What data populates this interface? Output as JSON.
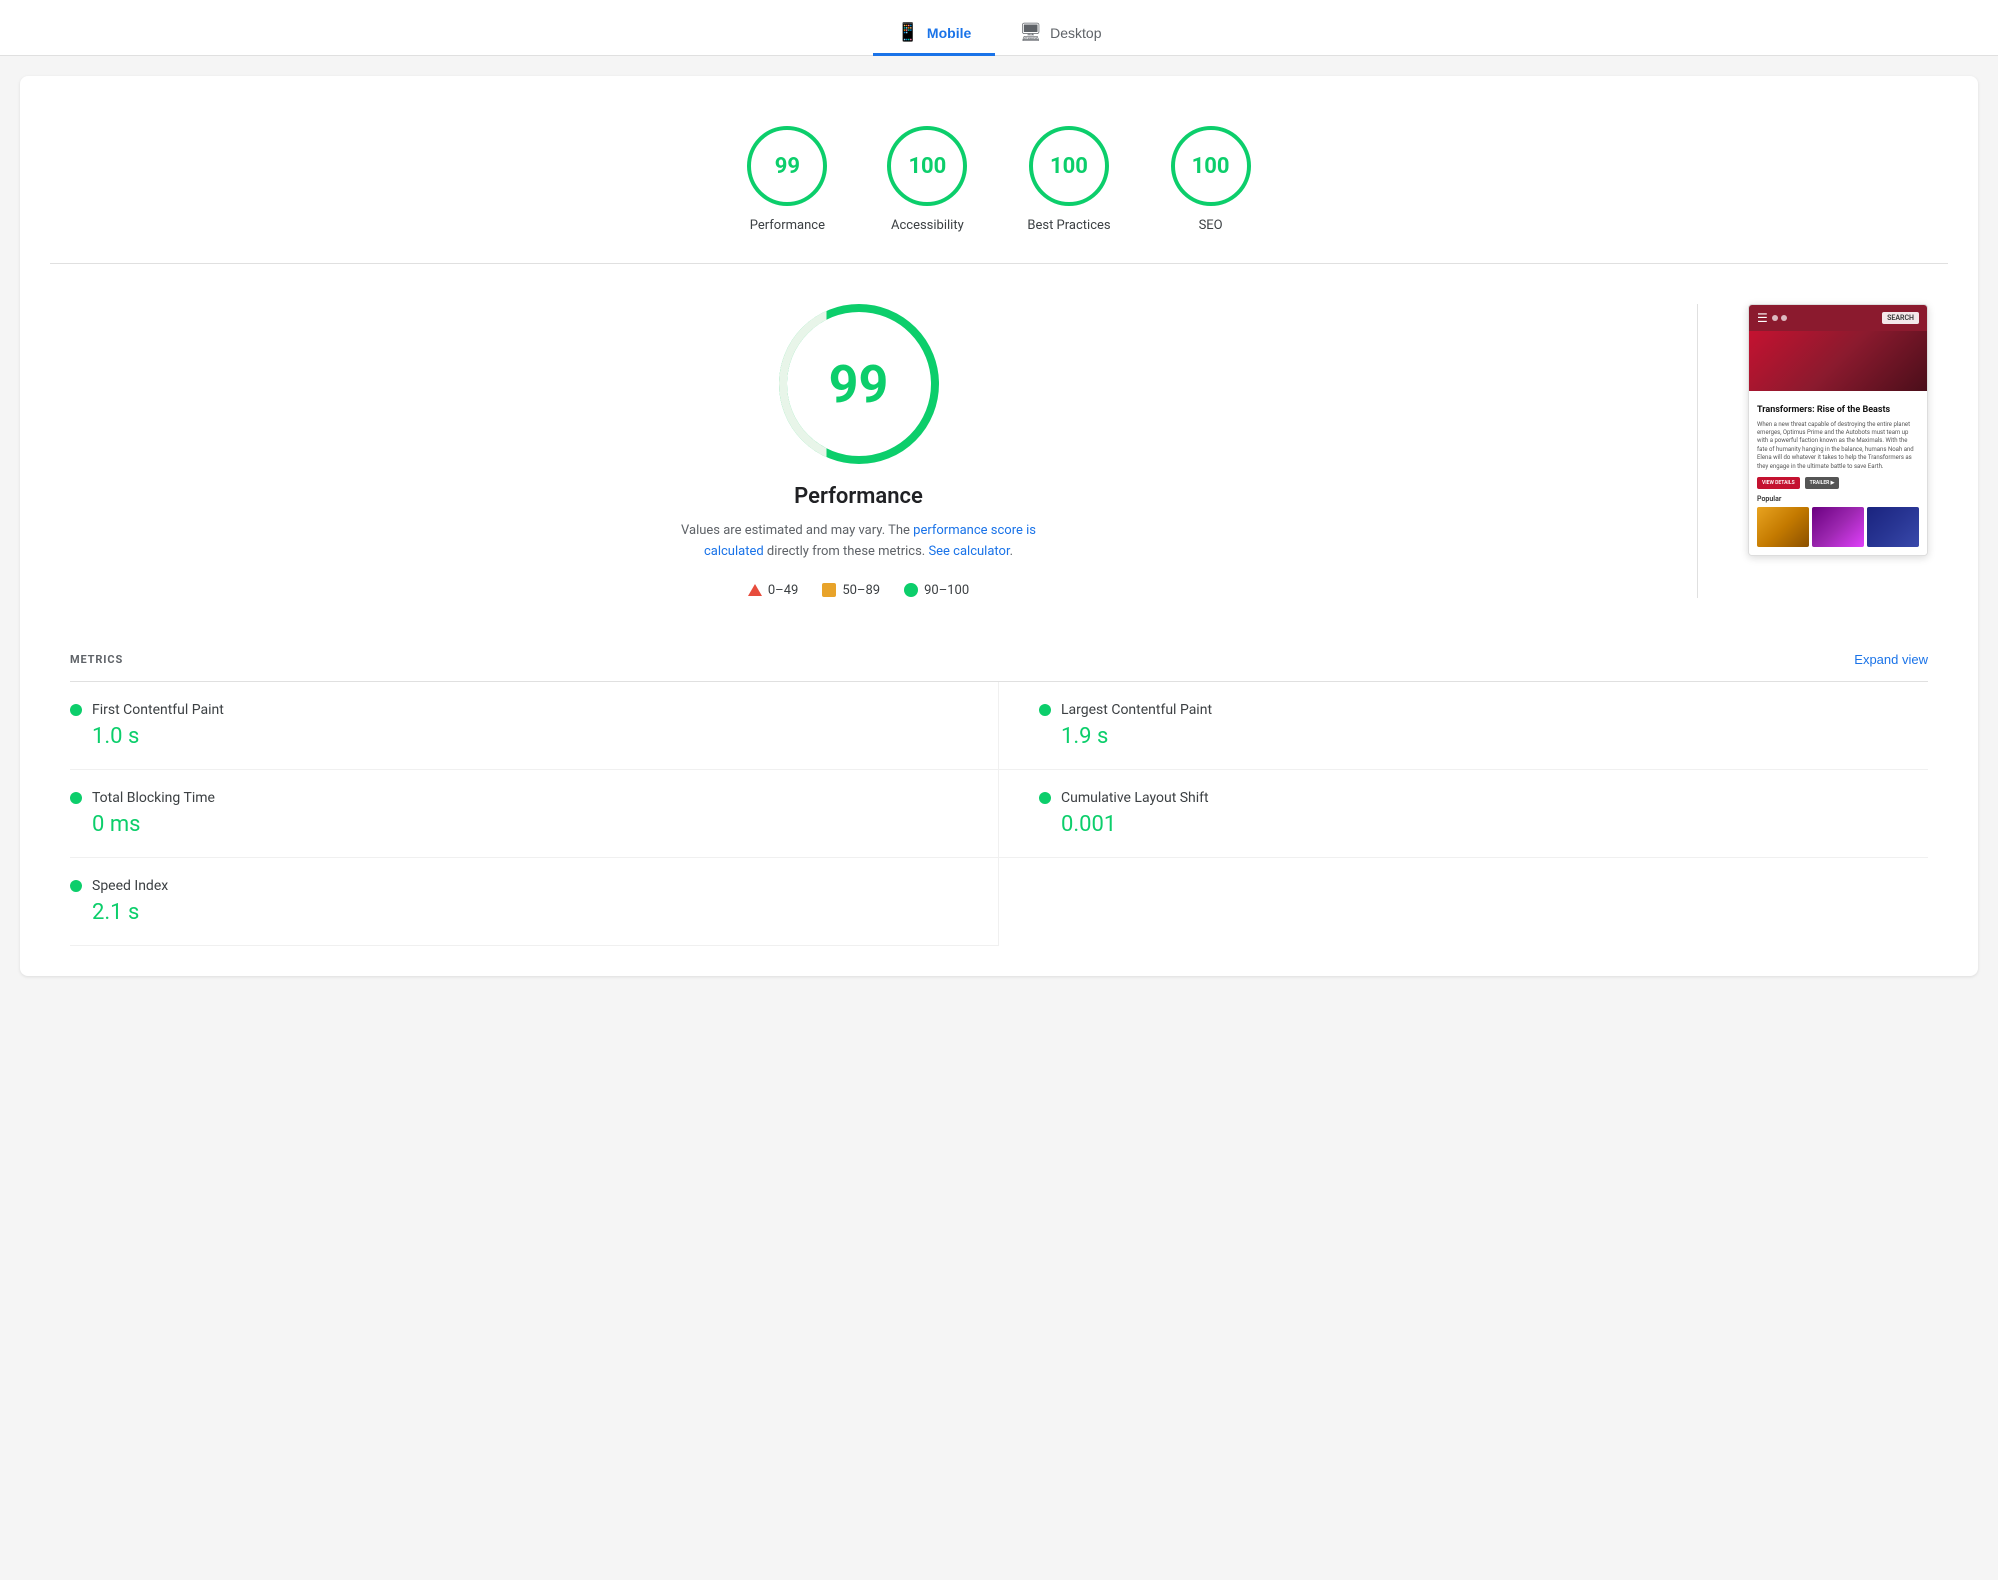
{
  "tabs": [
    {
      "id": "mobile",
      "label": "Mobile",
      "icon": "📱",
      "active": true
    },
    {
      "id": "desktop",
      "label": "Desktop",
      "icon": "🖥",
      "active": false
    }
  ],
  "scores": [
    {
      "id": "performance",
      "value": "99",
      "label": "Performance"
    },
    {
      "id": "accessibility",
      "value": "100",
      "label": "Accessibility"
    },
    {
      "id": "best-practices",
      "value": "100",
      "label": "Best Practices"
    },
    {
      "id": "seo",
      "value": "100",
      "label": "SEO"
    }
  ],
  "big_score": {
    "value": "99",
    "title": "Performance",
    "desc_before": "Values are estimated and may vary. The ",
    "desc_link1_text": "performance score is calculated",
    "desc_link1_href": "#",
    "desc_middle": " directly from these metrics. ",
    "desc_link2_text": "See calculator",
    "desc_link2_href": "#",
    "desc_end": "."
  },
  "legend": [
    {
      "id": "fail",
      "shape": "triangle",
      "range": "0–49",
      "color": "#e74c3c"
    },
    {
      "id": "average",
      "shape": "square",
      "range": "50–89",
      "color": "#e8a32a"
    },
    {
      "id": "pass",
      "shape": "circle",
      "range": "90–100",
      "color": "#0cce6b"
    }
  ],
  "screenshot": {
    "movie_title": "Transformers: Rise of the Beasts",
    "movie_desc": "When a new threat capable of destroying the entire planet emerges, Optimus Prime and the Autobots must team up with a powerful faction known as the Maximals. With the fate of humanity hanging in the balance, humans Noah and Elena will do whatever it takes to help the Transformers as they engage in the ultimate battle to save Earth.",
    "btn_view": "VIEW DETAILS",
    "btn_trailer": "TRAILER ▶",
    "search_label": "SEARCH",
    "popular_label": "Popular"
  },
  "metrics": {
    "section_title": "METRICS",
    "expand_label": "Expand view",
    "items": [
      {
        "id": "fcp",
        "name": "First Contentful Paint",
        "value": "1.0 s",
        "color": "#0cce6b"
      },
      {
        "id": "lcp",
        "name": "Largest Contentful Paint",
        "value": "1.9 s",
        "color": "#0cce6b"
      },
      {
        "id": "tbt",
        "name": "Total Blocking Time",
        "value": "0 ms",
        "color": "#0cce6b"
      },
      {
        "id": "cls",
        "name": "Cumulative Layout Shift",
        "value": "0.001",
        "color": "#0cce6b"
      },
      {
        "id": "si",
        "name": "Speed Index",
        "value": "2.1 s",
        "color": "#0cce6b"
      }
    ]
  }
}
